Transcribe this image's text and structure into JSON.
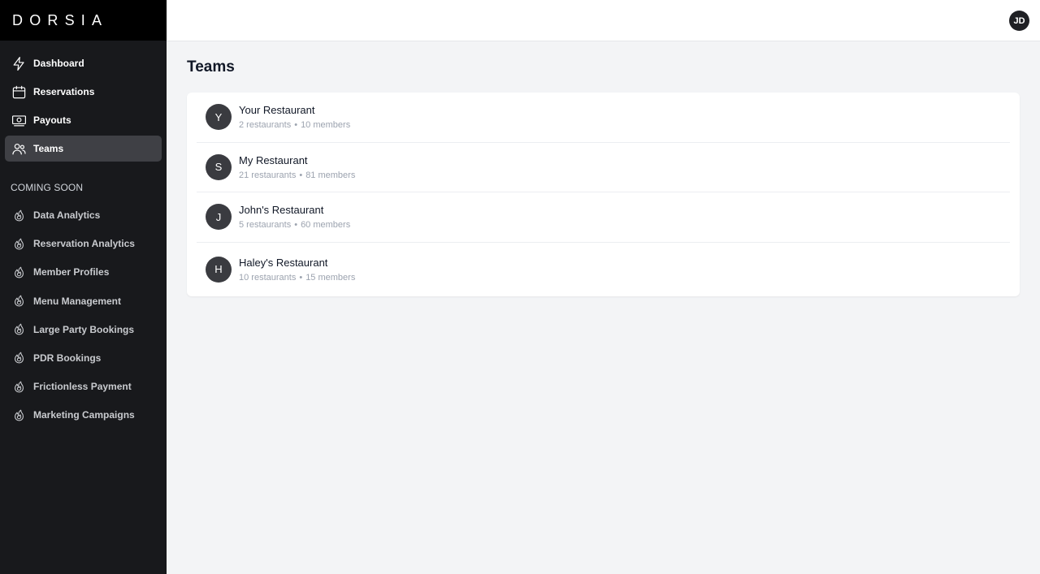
{
  "brand": "DORSIA",
  "user_initials": "JD",
  "nav": [
    {
      "label": "Dashboard",
      "icon": "bolt-icon",
      "active": false
    },
    {
      "label": "Reservations",
      "icon": "calendar-icon",
      "active": false
    },
    {
      "label": "Payouts",
      "icon": "cash-icon",
      "active": false
    },
    {
      "label": "Teams",
      "icon": "users-icon",
      "active": true
    }
  ],
  "coming_soon": {
    "label": "COMING SOON",
    "items": [
      {
        "label": "Data Analytics",
        "icon": "fire-icon"
      },
      {
        "label": "Reservation Analytics",
        "icon": "fire-icon"
      },
      {
        "label": "Member Profiles",
        "icon": "fire-icon"
      },
      {
        "label": "Menu Management",
        "icon": "fire-icon"
      },
      {
        "label": "Large Party Bookings",
        "icon": "fire-icon"
      },
      {
        "label": "PDR Bookings",
        "icon": "fire-icon"
      },
      {
        "label": "Frictionless Payment",
        "icon": "fire-icon"
      },
      {
        "label": "Marketing Campaigns",
        "icon": "fire-icon"
      }
    ]
  },
  "page_title": "Teams",
  "teams": [
    {
      "initial": "Y",
      "name": "Your Restaurant",
      "restaurants": "2 restaurants",
      "members": "10 members"
    },
    {
      "initial": "S",
      "name": "My Restaurant",
      "restaurants": "21 restaurants",
      "members": "81 members"
    },
    {
      "initial": "J",
      "name": "John's Restaurant",
      "restaurants": "5 restaurants",
      "members": "60 members"
    },
    {
      "initial": "H",
      "name": "Haley's Restaurant",
      "restaurants": "10 restaurants",
      "members": "15 members"
    }
  ],
  "meta_separator": "•",
  "colors": {
    "sidebar_bg": "#18191c",
    "brand_bg": "#000000",
    "active_item_bg": "#3f4045",
    "page_bg": "#f3f4f6",
    "avatar_bg": "#3a3b40"
  }
}
